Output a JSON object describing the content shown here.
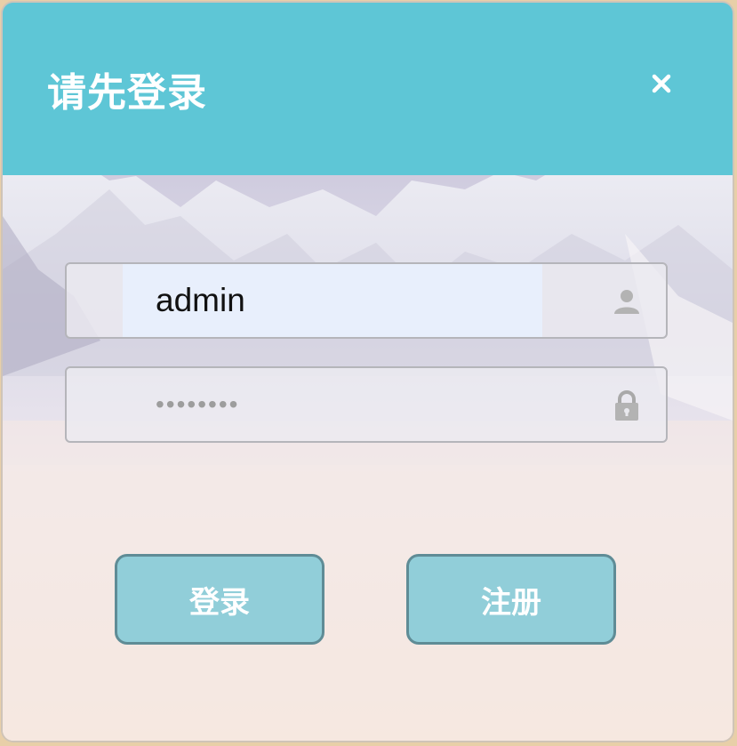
{
  "dialog": {
    "title": "请先登录",
    "close_icon": "close-icon"
  },
  "form": {
    "username": {
      "value": "admin",
      "icon": "user-icon"
    },
    "password": {
      "value": "••••••••",
      "icon": "lock-icon"
    }
  },
  "buttons": {
    "login_label": "登录",
    "register_label": "注册"
  },
  "colors": {
    "header": "#5ec6d6",
    "button": "#74c6d6",
    "button_border": "#5f8c96"
  }
}
